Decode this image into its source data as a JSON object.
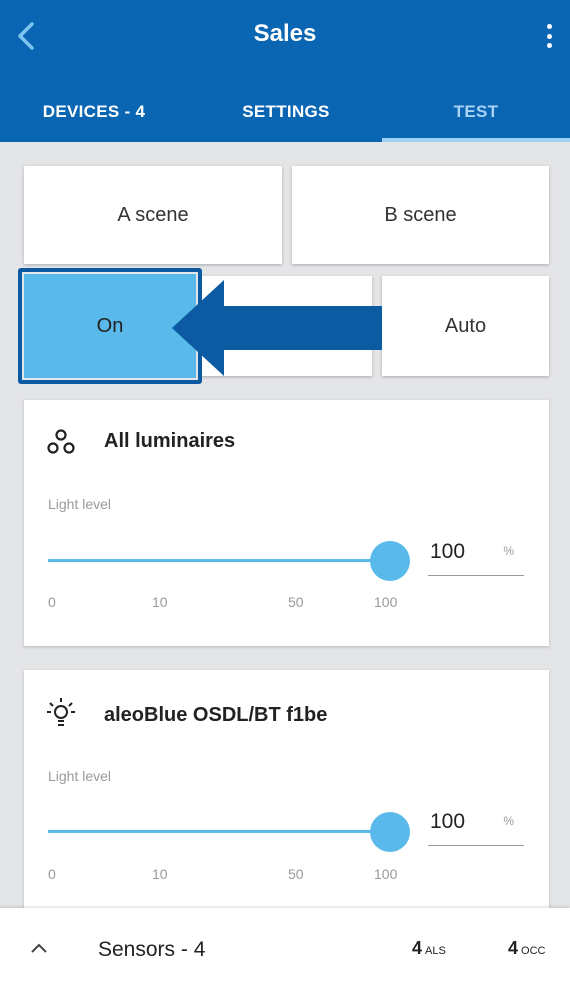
{
  "header": {
    "title": "Sales",
    "background_color": "#0a66b3",
    "back_icon": "chevron-left-icon",
    "menu_icon": "more-vertical-icon"
  },
  "tabs": [
    {
      "label": "DEVICES - 4",
      "active": false
    },
    {
      "label": "SETTINGS",
      "active": false
    },
    {
      "label": "TEST",
      "active": true
    }
  ],
  "scenes": {
    "a_label": "A scene",
    "b_label": "B scene"
  },
  "modes": {
    "on_label": "On",
    "auto_label": "Auto",
    "selected": "On",
    "selected_color": "#58b9ea"
  },
  "annotation": {
    "arrow_color": "#0b5aa2",
    "points_to": "On"
  },
  "cards": [
    {
      "icon": "group-luminaires-icon",
      "title": "All luminaires",
      "light_label": "Light level",
      "slider_value_percent": 100,
      "value": "100",
      "unit": "%",
      "ticks": [
        "0",
        "10",
        "50",
        "100"
      ]
    },
    {
      "icon": "lightbulb-icon",
      "title": "aleoBlue OSDL/BT f1be",
      "light_label": "Light level",
      "slider_value_percent": 100,
      "value": "100",
      "unit": "%",
      "ticks": [
        "0",
        "10",
        "50",
        "100"
      ]
    }
  ],
  "sensors_bar": {
    "chevron_icon": "chevron-up-icon",
    "title": "Sensors - 4",
    "als_count": "4",
    "als_label": "ALS",
    "occ_count": "4",
    "occ_label": "OCC"
  }
}
